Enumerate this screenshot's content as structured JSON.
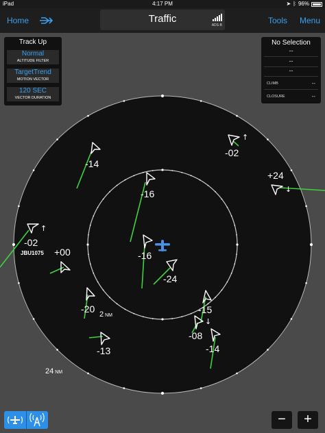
{
  "status": {
    "device": "iPad",
    "time": "4:17 PM",
    "battery": "96%",
    "battery_level": 0.96
  },
  "nav": {
    "home": "Home",
    "title": "Traffic",
    "source": "ADS-B",
    "tools": "Tools",
    "menu": "Menu"
  },
  "settings": {
    "header": "Track Up",
    "items": [
      {
        "value": "Normal",
        "label": "ALTITUDE FILTER"
      },
      {
        "value": "TargetTrend",
        "label": "MOTION VECTOR"
      },
      {
        "value": "120 SEC",
        "label": "VECTOR DURATION"
      }
    ]
  },
  "selection": {
    "title": "No Selection",
    "line1": "--",
    "line2": "--",
    "line3": "--",
    "climb_label": "CLIMB",
    "climb_value": "--",
    "closure_label": "CLOSURE",
    "closure_value": "--"
  },
  "rings": {
    "inner_label": "2 NM",
    "outer_label": "24 NM",
    "inner_num": "2",
    "outer_num": "24",
    "unit": "NM"
  },
  "targets": [
    {
      "label": "-14",
      "trend": ""
    },
    {
      "label": "-02",
      "trend": "up"
    },
    {
      "label": "+24",
      "trend": "down"
    },
    {
      "label": "-16",
      "trend": ""
    },
    {
      "label": "-02",
      "trend": "up",
      "callsign": "JBU1075"
    },
    {
      "label": "+00",
      "trend": ""
    },
    {
      "label": "-16",
      "trend": ""
    },
    {
      "label": "-24",
      "trend": ""
    },
    {
      "label": "-20",
      "trend": ""
    },
    {
      "label": "-15",
      "trend": ""
    },
    {
      "label": "-08",
      "trend": "down"
    },
    {
      "label": "-13",
      "trend": ""
    },
    {
      "label": "-14",
      "trend": ""
    }
  ],
  "zoom": {
    "minus": "−",
    "plus": "+"
  },
  "colors": {
    "accent": "#3aa0f0",
    "vector": "#3fd13f",
    "ownship": "#4a90e8"
  }
}
